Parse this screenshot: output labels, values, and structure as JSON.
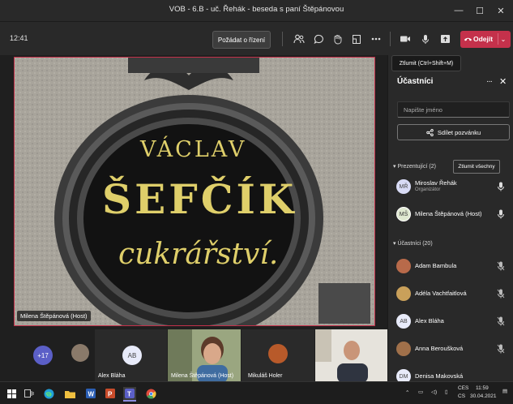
{
  "window": {
    "title": "VOB - 6.B - uč. Řehák - beseda s paní Štěpánovou"
  },
  "toolbar": {
    "time": "12:41",
    "request_control_label": "Požádat o řízení",
    "leave_label": "Odejít",
    "mute_tooltip": "Ztlumit (Ctrl+Shift+M)"
  },
  "video": {
    "sign_line1": "VÁCLAV",
    "sign_line2": "ŠEFČÍK",
    "sign_line3": "cukrářství.",
    "presenter_name": "Milena Štěpánová (Host)"
  },
  "strip": {
    "overflow_count": "+17",
    "tiles": [
      {
        "name": "Alex Bláha",
        "initials": "AB"
      },
      {
        "name": "Milena Štěpánová (Host)"
      },
      {
        "name": "Mikuláš Holer"
      }
    ]
  },
  "participants_panel": {
    "title": "Účastníci",
    "search_placeholder": "Napište jméno",
    "share_invite_label": "Sdílet pozvánku",
    "presenters_header": "Prezentující (2)",
    "mute_all_label": "Ztlumit všechny",
    "presenters": [
      {
        "name": "Miroslav Řehák",
        "role": "Organizátor",
        "initials": "MŘ"
      },
      {
        "name": "Milena Štěpánová (Host)",
        "initials": "MŠ"
      }
    ],
    "attendees_header": "Účastníci (20)",
    "attendees": [
      {
        "name": "Adam Bambula"
      },
      {
        "name": "Adéla Vachtfaitlová"
      },
      {
        "name": "Alex Bláha",
        "initials": "AB"
      },
      {
        "name": "Anna Beroušková"
      },
      {
        "name": "Denisa Makovská",
        "initials": "DM"
      }
    ]
  },
  "taskbar": {
    "lang": "CES",
    "lang2": "CS",
    "clock_time": "11:59",
    "clock_date": "30.04.2021"
  },
  "colors": {
    "leave": "#c4314b",
    "accent": "#6264a7",
    "panel": "#292929"
  }
}
